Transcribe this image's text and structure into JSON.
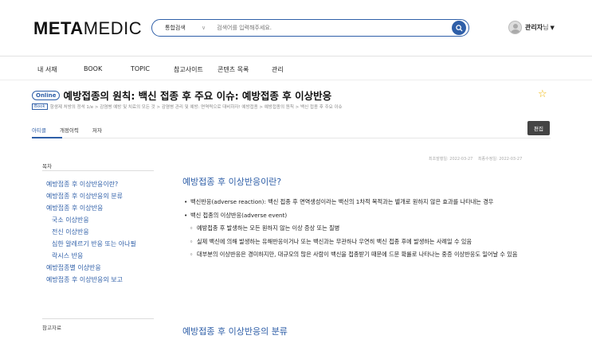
{
  "header": {
    "logo_bold": "META",
    "logo_light": "MEDIC",
    "search_scope": "통합검색",
    "search_placeholder": "검색어를 입력해주세요.",
    "user_name": "관리자",
    "user_suffix": "님",
    "user_caret": "▼"
  },
  "nav": [
    "내 서재",
    "BOOK",
    "TOPIC",
    "참고사이트",
    "콘텐츠 목록",
    "관리"
  ],
  "page": {
    "badge": "Online",
    "title": "예방접종의 원칙: 백신 접종 후 주요 이슈: 예방접종 후 이상반응",
    "book_badge": "Book",
    "breadcrumb": "항생제 처방의 정석 1/e > 감염병 예방 및 치료의 모든 것 > 감염병 관리 및 예방: 면역력으로 대비하자! 예방접종 > 예방접종의 원칙 > 백신 접종 후 주요 이슈"
  },
  "tabs": [
    "아티클",
    "개정이력",
    "저자"
  ],
  "edit_label": "편집",
  "toc": {
    "heading": "목차",
    "items": [
      {
        "label": "예방접종 후 이상반응이란?",
        "sub": false
      },
      {
        "label": "예방접종 후 이상반응의 분류",
        "sub": false
      },
      {
        "label": "예방접종 후 이상반응",
        "sub": false
      },
      {
        "label": "국소 이상반응",
        "sub": true
      },
      {
        "label": "전신 이상반응",
        "sub": true
      },
      {
        "label": "심한 알레르기 반응 또는 아나필",
        "sub": true
      },
      {
        "label": "락시스 반응",
        "sub": true
      },
      {
        "label": "예방접종별 이상반응",
        "sub": false
      },
      {
        "label": "예방접종 후 이상반응의 보고",
        "sub": false
      }
    ],
    "ref_heading": "참고자료"
  },
  "dates": {
    "created": "최초발행일: 2022-03-27",
    "modified": "최종수정일: 2022-03-27"
  },
  "content": {
    "h1": "예방접종 후 이상반응이란?",
    "b1": "백신반응(adverse reaction): 백신 접종 후 면역생성이라는 백신의 1차적 목적과는 별개로 원하지 않은 효과를 나타내는 경우",
    "b2": "백신 접종의 이상반응(adverse event)",
    "s1": "예방접종 후 발생하는 모든 원하지 않는 이상 증상 또는 질병",
    "s2": "실제 백신에 의해 발생하는 유해반응이거나 또는 백신과는 무관하나 우연히 백신 접종 후에 발생하는 사례일 수 있음",
    "s3": "대부분의 이상반응은 경미하지만, 대규모의 많은 사람이 백신을 접종받기 때문에 드문 확률로 나타나는 중증 이상반응도 일어날 수 있음",
    "h2": "예방접종 후 이상반응의 분류"
  },
  "colors": {
    "accent": "#2f5fa8",
    "star": "#f0b400",
    "edit_button": "#444444"
  },
  "icons": [
    "search-icon",
    "avatar-icon",
    "star-icon",
    "chevron-down-icon"
  ]
}
